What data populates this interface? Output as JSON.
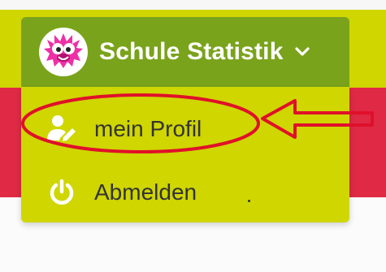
{
  "user_menu": {
    "username": "Schule Statistik",
    "avatar_icon": "pink-monster-mascot-icon",
    "toggle_icon": "chevron-down-icon"
  },
  "dropdown": {
    "items": [
      {
        "label": "mein Profil",
        "icon": "user-edit-icon"
      },
      {
        "label": "Abmelden",
        "icon": "power-icon"
      }
    ]
  },
  "annotation": {
    "highlight": "red-ellipse-around-mein-profil",
    "pointer": "red-outline-arrow-pointing-left"
  },
  "colors": {
    "header_yellow": "#cfd600",
    "button_green": "#7aa31c",
    "banner_red": "#e02a45",
    "annotation_red": "#e0102a",
    "icon_white": "#ffffff"
  }
}
